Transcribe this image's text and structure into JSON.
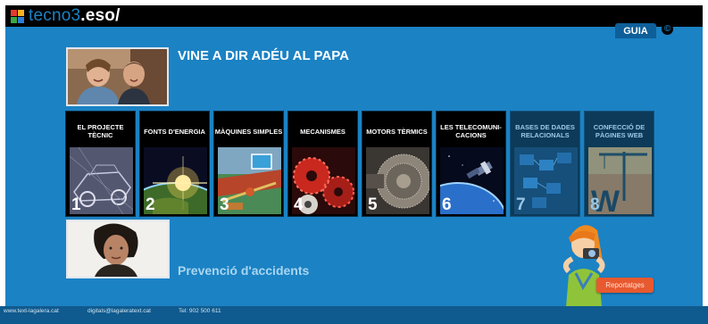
{
  "header": {
    "logo_prefix": "tecno3",
    "logo_suffix": ".eso/",
    "logo_colors": [
      "#e63c2d",
      "#f3b321",
      "#3aa845",
      "#2e7dd7"
    ],
    "guia_label": "GUIA",
    "copyright_symbol": "©"
  },
  "featured_video": {
    "title": "VINE A DIR ADÉU AL PAPA"
  },
  "modules": [
    {
      "label": "EL PROJECTE TÈCNIC",
      "number": "1",
      "enabled": true
    },
    {
      "label": "FONTS D'ENERGIA",
      "number": "2",
      "enabled": true
    },
    {
      "label": "MÀQUINES SIMPLES",
      "number": "3",
      "enabled": true
    },
    {
      "label": "MECANISMES",
      "number": "4",
      "enabled": true
    },
    {
      "label": "MOTORS TÈRMICS",
      "number": "5",
      "enabled": true
    },
    {
      "label": "LES TELECOMUNI-CACIONS",
      "number": "6",
      "enabled": true
    },
    {
      "label": "BASES DE DADES RELACIONALS",
      "number": "7",
      "enabled": false
    },
    {
      "label": "CONFECCIÓ DE PÀGINES WEB",
      "number": "8",
      "enabled": false
    }
  ],
  "second_video": {
    "title": "Prevenció d'accidents"
  },
  "report_button": {
    "label": "Reportatges"
  },
  "footer": {
    "site": "www.text-lagalera.cat",
    "email": "digitals@lagaleratext.cat",
    "phone": "Tel: 902 500 611"
  },
  "colors": {
    "background": "#1b82c4",
    "topbar": "#000000",
    "tab": "#0e5f99",
    "button": "#e8592f"
  }
}
